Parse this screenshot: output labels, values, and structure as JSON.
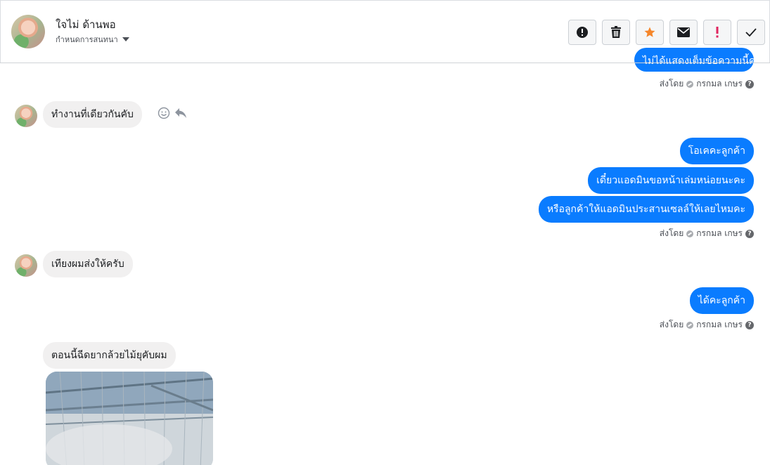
{
  "header": {
    "contact_name": "ใจไม่ ด้านพอ",
    "conversation_setting": "กำหนดการสนทนา",
    "toolbar": [
      {
        "name": "spam-button",
        "icon": "alert-circle-icon"
      },
      {
        "name": "delete-button",
        "icon": "trash-icon"
      },
      {
        "name": "star-button",
        "icon": "star-icon"
      },
      {
        "name": "mark-unread-button",
        "icon": "envelope-icon"
      },
      {
        "name": "important-button",
        "icon": "exclamation-icon"
      },
      {
        "name": "done-button",
        "icon": "check-icon"
      }
    ]
  },
  "messages": {
    "cutoff_out": "ไม่ได้แสดงเต็มข้อความนี้ค่ะ",
    "in1": "ทำงานที่เดียวกันคับ",
    "out1": "โอเคคะลูกค้า",
    "out2": "เดี๋ยวแอดมินขอหน้าเล่มหน่อยนะคะ",
    "out3": "หรือลูกค้าให้แอดมินประสานเซลล์ให้เลยไหมคะ",
    "in2": "เทียงผมส่งให้ครับ",
    "out4": "ได้คะลูกค้า",
    "in3": "ตอนนี้ฉีดยากล้วยไม้ยุคับผม"
  },
  "sent_by": {
    "label": "ส่งโดย",
    "agent": "กรกมล เกษร"
  },
  "colors": {
    "outgoing_bubble": "#0a7cff",
    "incoming_bubble": "#f1f0f0",
    "star": "#f5862b",
    "important": "#e0245e"
  }
}
